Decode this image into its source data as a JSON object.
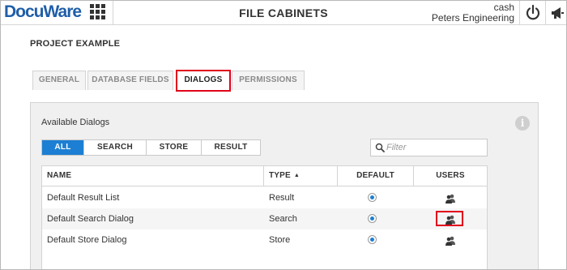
{
  "header": {
    "logo": "DocuWare",
    "title": "FILE CABINETS",
    "user_name": "cash",
    "organization": "Peters Engineering",
    "icons": [
      "apps-grid-icon",
      "power-icon",
      "megaphone-icon"
    ]
  },
  "project": {
    "title": "PROJECT EXAMPLE"
  },
  "tabs": [
    {
      "label": "GENERAL",
      "active": false
    },
    {
      "label": "DATABASE FIELDS",
      "active": false
    },
    {
      "label": "DIALOGS",
      "active": true,
      "highlighted": true
    },
    {
      "label": "PERMISSIONS",
      "active": false
    }
  ],
  "panel": {
    "heading": "Available Dialogs",
    "filters": [
      {
        "label": "ALL",
        "active": true
      },
      {
        "label": "SEARCH",
        "active": false
      },
      {
        "label": "STORE",
        "active": false
      },
      {
        "label": "RESULT",
        "active": false
      }
    ],
    "filter_input": {
      "placeholder": "Filter",
      "value": ""
    },
    "table": {
      "columns": [
        {
          "label": "NAME"
        },
        {
          "label": "TYPE",
          "sort": "ascending"
        },
        {
          "label": "DEFAULT"
        },
        {
          "label": "USERS"
        }
      ],
      "rows": [
        {
          "name": "Default Result List",
          "type": "Result",
          "default": true,
          "users_icon": "users-icon",
          "highlighted": false
        },
        {
          "name": "Default Search Dialog",
          "type": "Search",
          "default": true,
          "users_icon": "users-icon",
          "highlighted": true
        },
        {
          "name": "Default Store Dialog",
          "type": "Store",
          "default": true,
          "users_icon": "users-icon",
          "highlighted": false
        }
      ]
    }
  },
  "colors": {
    "accent": "#1c7fd3",
    "highlight": "#e0001b",
    "logo": "#1f5ea8"
  }
}
